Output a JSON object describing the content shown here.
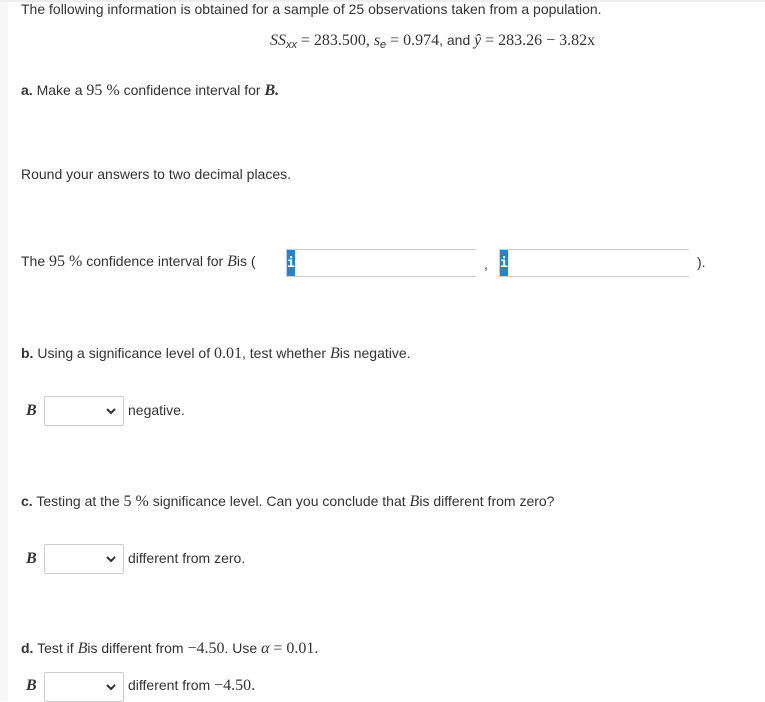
{
  "intro": "The following information is obtained for a sample of 25 observations taken from a population.",
  "given": {
    "ssxx_label": "SS",
    "ssxx_sub": "xx",
    "ssxx_value": "= 283.500,",
    "se_label": "s",
    "se_sub": "e",
    "se_value": "= 0.974",
    "and_text": ", and",
    "yhat": "ŷ",
    "equation": "= 283.26 − 3.82x"
  },
  "part_a": {
    "letter": "a.",
    "text_pre": "Make a",
    "percent": "95 %",
    "text_post": "confidence interval for",
    "var": "B.",
    "round_note": "Round your answers to two decimal places.",
    "ci_pre": "The",
    "ci_percent": "95 %",
    "ci_mid": "confidence interval for",
    "ci_var": "B",
    "ci_is": "is (",
    "comma": ",",
    "close": ").",
    "info_icon": "i",
    "lower_value": "",
    "upper_value": ""
  },
  "part_b": {
    "letter": "b.",
    "text_pre": "Using a significance level of",
    "alpha": "0.01",
    "text_mid": ", test whether",
    "var": "B",
    "text_post": "is negative.",
    "row_var": "B",
    "select_value": "",
    "row_suffix": "negative."
  },
  "part_c": {
    "letter": "c.",
    "text_pre": "Testing at the",
    "percent": "5 %",
    "text_mid": "significance level. Can you conclude that",
    "var": "B",
    "text_post": "is different from zero?",
    "row_var": "B",
    "select_value": "",
    "row_suffix": "different from zero."
  },
  "part_d": {
    "letter": "d.",
    "text_pre": "Test if",
    "var": "B",
    "text_mid": "is different from",
    "value": "−4.50",
    "text_use": ". Use",
    "alpha_sym": "α",
    "alpha_val": "= 0.01.",
    "row_var": "B",
    "select_value": "",
    "row_suffix_text": "different from",
    "row_suffix_value": "−4.50."
  },
  "colors": {
    "info_button": "#1a88d8",
    "input_border": "#cccccc",
    "text": "#333333"
  }
}
